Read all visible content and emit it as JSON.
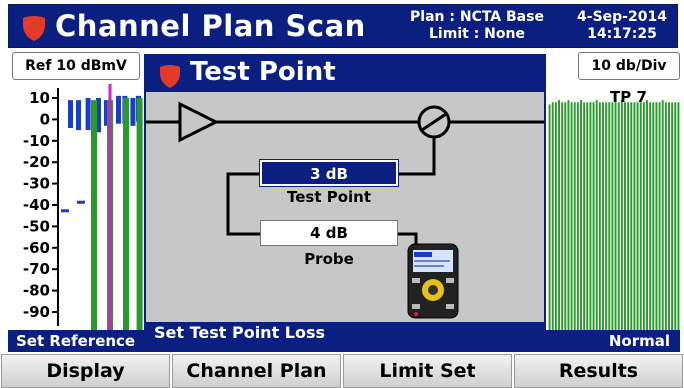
{
  "header": {
    "title": "Channel Plan Scan",
    "plan_line": "Plan : NCTA Base",
    "limit_line": "Limit : None",
    "date": "4-Sep-2014",
    "time": "14:17:25"
  },
  "controls": {
    "ref_level": "Ref 10 dBmV",
    "scale": "10 db/Div"
  },
  "chart_data": {
    "type": "bar",
    "yticks": [
      "10",
      "0",
      "-10",
      "-20",
      "-30",
      "-40",
      "-50",
      "-60",
      "-70",
      "-80",
      "-90"
    ],
    "ylim": [
      -100,
      10
    ],
    "marker_label": "TP 7",
    "colors": {
      "green": "#2a9a2a",
      "blue": "#1a3cc8",
      "marker": "#d21fd2"
    },
    "left_green_bars": [
      {
        "x": 0.4,
        "level": 9
      },
      {
        "x": 0.6,
        "level": 9
      },
      {
        "x": 0.8,
        "level": 10
      },
      {
        "x": 0.97,
        "level": 10
      }
    ],
    "left_blue_bars": [
      {
        "x": 0.1,
        "top": 9,
        "bottom": -4
      },
      {
        "x": 0.2,
        "top": 9,
        "bottom": -5
      },
      {
        "x": 0.32,
        "top": 10,
        "bottom": -5
      },
      {
        "x": 0.45,
        "top": 10,
        "bottom": -6
      },
      {
        "x": 0.55,
        "top": 9,
        "bottom": -3
      },
      {
        "x": 0.7,
        "top": 11,
        "bottom": -2
      },
      {
        "x": 0.78,
        "top": 11,
        "bottom": -2
      },
      {
        "x": 0.88,
        "top": 10,
        "bottom": -3
      },
      {
        "x": 0.95,
        "top": 11,
        "bottom": -1
      }
    ],
    "small_blue_segments": [
      {
        "x": 0.05,
        "level": -42
      },
      {
        "x": 0.25,
        "level": -38
      }
    ],
    "right_green_levels": [
      7,
      8,
      8,
      9,
      8,
      8,
      9,
      8,
      8,
      8,
      9,
      8,
      8,
      8,
      8,
      9,
      8,
      8,
      8,
      8,
      8,
      8,
      8,
      9,
      8,
      8,
      8,
      8,
      8,
      8,
      8,
      9,
      8,
      8,
      8,
      8,
      9,
      8,
      8,
      8,
      8,
      8
    ]
  },
  "status": {
    "left": "Set Reference",
    "right": "Normal"
  },
  "softkeys": [
    "Display",
    "Channel Plan",
    "Limit Set",
    "Results"
  ],
  "popup": {
    "title": "Test Point",
    "test_point_value": "3 dB",
    "test_point_label": "Test Point",
    "probe_value": "4 dB",
    "probe_label": "Probe",
    "footer": "Set Test Point Loss"
  }
}
